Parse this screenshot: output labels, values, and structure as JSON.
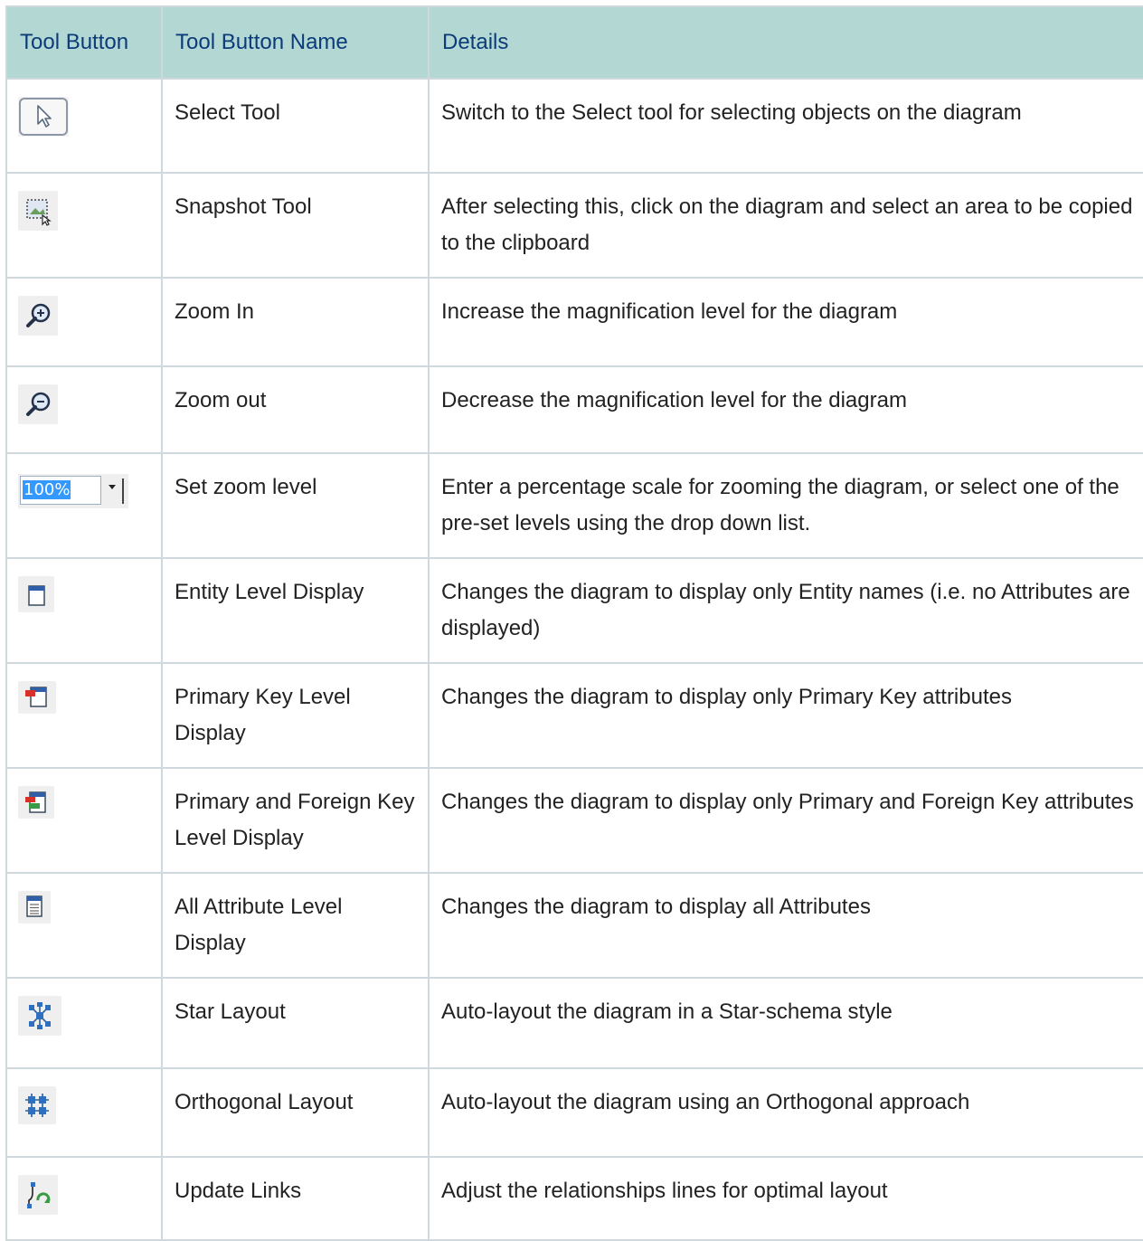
{
  "header": {
    "col1": "Tool Button",
    "col2": "Tool Button Name",
    "col3": "Details"
  },
  "rows": [
    {
      "icon": "select-tool-icon",
      "name": "Select Tool",
      "details": "Switch to the Select tool for selecting objects on the diagram"
    },
    {
      "icon": "snapshot-tool-icon",
      "name": "Snapshot Tool",
      "details": "After selecting this, click on the diagram and select an area to be copied to the clipboard"
    },
    {
      "icon": "zoom-in-icon",
      "name": "Zoom In",
      "details": "Increase the magnification level for the diagram"
    },
    {
      "icon": "zoom-out-icon",
      "name": "Zoom out",
      "details": "Decrease the magnification level for the diagram"
    },
    {
      "icon": "zoom-level-dropdown",
      "zoom_value": "100%",
      "name": "Set zoom level",
      "details": "Enter a percentage scale for zooming the diagram, or select one of the pre-set levels using the drop down list."
    },
    {
      "icon": "entity-level-icon",
      "name": "Entity Level Display",
      "details": "Changes the diagram to display only Entity names (i.e. no Attributes are displayed)"
    },
    {
      "icon": "primary-key-level-icon",
      "name": "Primary Key Level Display",
      "details": "Changes the diagram to display only Primary Key attributes"
    },
    {
      "icon": "primary-foreign-key-level-icon",
      "name": "Primary and Foreign Key Level Display",
      "details": "Changes the diagram to display only Primary and Foreign Key attributes"
    },
    {
      "icon": "all-attribute-level-icon",
      "name": "All Attribute Level Display",
      "details": "Changes the diagram to display all Attributes"
    },
    {
      "icon": "star-layout-icon",
      "name": "Star Layout",
      "details": "Auto-layout the diagram in a Star-schema style"
    },
    {
      "icon": "orthogonal-layout-icon",
      "name": "Orthogonal Layout",
      "details": "Auto-layout the diagram using an Orthogonal approach"
    },
    {
      "icon": "update-links-icon",
      "name": "Update Links",
      "details": "Adjust the relationships lines for optimal layout"
    }
  ],
  "colors": {
    "header_bg": "#b3d8d4",
    "header_text": "#0b3b79",
    "border": "#cfd8dd"
  }
}
